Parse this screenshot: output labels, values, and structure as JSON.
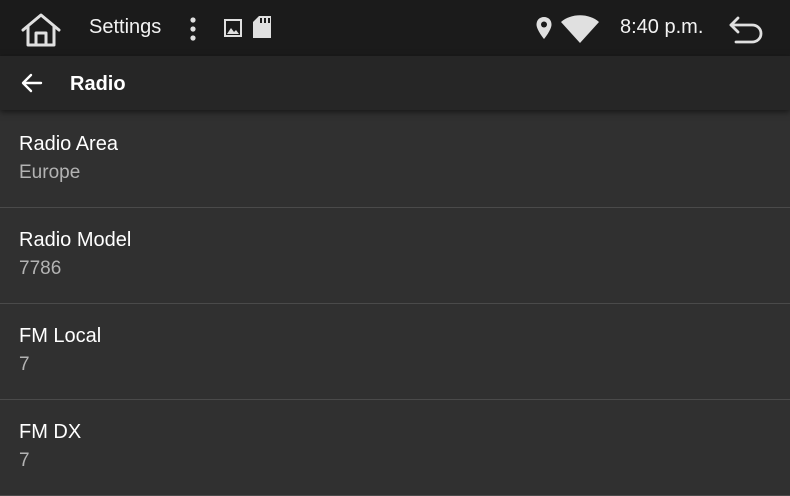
{
  "statusbar": {
    "title": "Settings",
    "time": "8:40 p.m.",
    "icons": [
      "home-icon",
      "more-vert-icon",
      "image-icon",
      "sd-card-icon",
      "location-icon",
      "wifi-icon",
      "back-icon"
    ]
  },
  "appbar": {
    "title": "Radio",
    "back_icon": "arrow-left-icon"
  },
  "settings": [
    {
      "title": "Radio Area",
      "value": "Europe"
    },
    {
      "title": "Radio Model",
      "value": "7786"
    },
    {
      "title": "FM Local",
      "value": "7"
    },
    {
      "title": "FM DX",
      "value": "7"
    }
  ],
  "colors": {
    "statusbar_bg": "#1b1b1b",
    "appbar_bg": "#262626",
    "content_bg": "#303030",
    "divider": "#4a4a4a",
    "secondary_text": "#b3b3b3"
  }
}
